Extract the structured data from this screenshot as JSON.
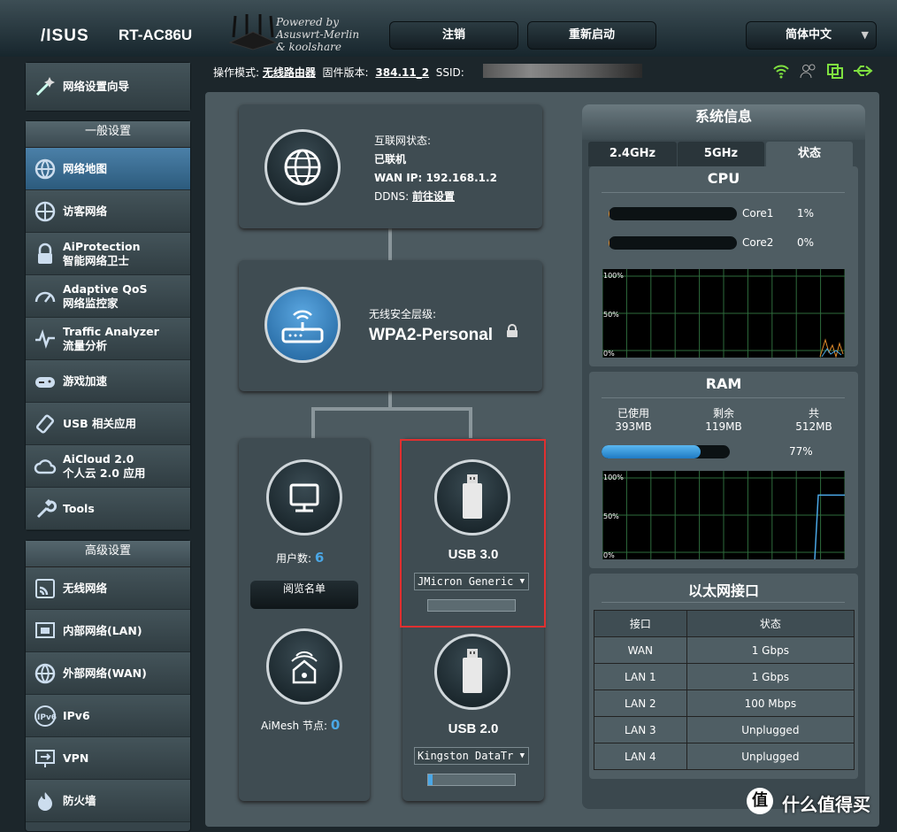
{
  "header": {
    "brand": "/ISUS",
    "model": "RT-AC86U",
    "powered": "Powered by\nAsuswrt-Merlin\n& koolshare",
    "logout": "注销",
    "reboot": "重新启动",
    "language": "简体中文"
  },
  "infobar": {
    "mode_label": "操作模式:",
    "mode_value": "无线路由器",
    "fw_label": "固件版本:",
    "fw_value": "384.11_2",
    "ssid_label": "SSID:"
  },
  "sidebar": {
    "wizard": "网络设置向导",
    "general_title": "一般设置",
    "general": [
      {
        "l1": "网络地图",
        "icon": "map-icon"
      },
      {
        "l1": "访客网络",
        "icon": "globe-icon"
      },
      {
        "l1": "AiProtection",
        "l2": "智能网络卫士",
        "icon": "lock-icon"
      },
      {
        "l1": "Adaptive QoS",
        "l2": "网络监控家",
        "icon": "gauge-icon"
      },
      {
        "l1": "Traffic Analyzer",
        "l2": "流量分析",
        "icon": "pulse-icon"
      },
      {
        "l1": "游戏加速",
        "icon": "gamepad-icon"
      },
      {
        "l1": "USB 相关应用",
        "icon": "usb-icon"
      },
      {
        "l1": "AiCloud 2.0",
        "l2": "个人云 2.0 应用",
        "icon": "cloud-icon"
      },
      {
        "l1": "Tools",
        "icon": "wrench-icon"
      }
    ],
    "advanced_title": "高级设置",
    "advanced": [
      {
        "l1": "无线网络",
        "icon": "wifi-icon"
      },
      {
        "l1": "内部网络(LAN)",
        "icon": "lan-icon"
      },
      {
        "l1": "外部网络(WAN)",
        "icon": "wan-icon"
      },
      {
        "l1": "IPv6",
        "icon": "ipv6-icon"
      },
      {
        "l1": "VPN",
        "icon": "vpn-icon"
      },
      {
        "l1": "防火墙",
        "icon": "firewall-icon"
      }
    ]
  },
  "internet": {
    "status_label": "互联网状态:",
    "status": "已联机",
    "wan_ip": "WAN IP: 192.168.1.2",
    "ddns_label": "DDNS:",
    "ddns_link": "前往设置"
  },
  "security": {
    "label": "无线安全层级:",
    "value": "WPA2-Personal"
  },
  "clients": {
    "label": "用户数:",
    "count": "6",
    "button": "阅览名单"
  },
  "aimesh": {
    "label": "AiMesh 节点:",
    "count": "0"
  },
  "usb3": {
    "title": "USB 3.0",
    "device": "JMicron Generic"
  },
  "usb2": {
    "title": "USB 2.0",
    "device": "Kingston DataTr",
    "usage": 0.05
  },
  "sysinfo": {
    "title": "系统信息",
    "tabs": [
      "2.4GHz",
      "5GHz",
      "状态"
    ],
    "cpu": {
      "title": "CPU",
      "cores": [
        {
          "name": "Core1",
          "pct": "1%",
          "value": 0.01
        },
        {
          "name": "Core2",
          "pct": "0%",
          "value": 0
        }
      ],
      "axis": [
        "100%",
        "50%",
        "0%"
      ]
    },
    "ram": {
      "title": "RAM",
      "used_label": "已使用",
      "used": "393MB",
      "free_label": "剩余",
      "free": "119MB",
      "total_label": "共",
      "total": "512MB",
      "pct": "77%",
      "value": 0.77,
      "axis": [
        "100%",
        "50%",
        "0%"
      ]
    },
    "eth": {
      "title": "以太网接口",
      "headers": [
        "接口",
        "状态"
      ],
      "rows": [
        [
          "WAN",
          "1 Gbps"
        ],
        [
          "LAN 1",
          "1 Gbps"
        ],
        [
          "LAN 2",
          "100 Mbps"
        ],
        [
          "LAN 3",
          "Unplugged"
        ],
        [
          "LAN 4",
          "Unplugged"
        ]
      ]
    }
  },
  "watermark": "什么值得买",
  "colors": {
    "accent": "#4aa7e6",
    "highlight": "#e03030",
    "wifi": "#7fe040"
  }
}
